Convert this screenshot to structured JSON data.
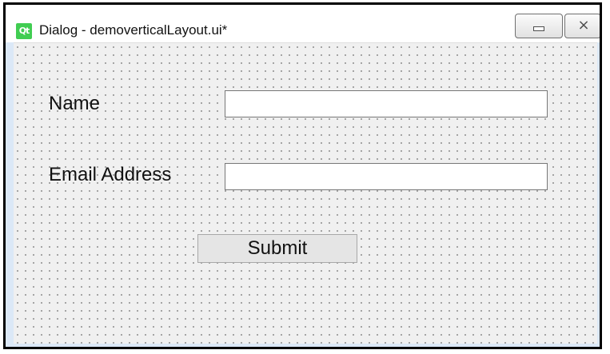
{
  "window": {
    "title": "Dialog - demoverticalLayout.ui*",
    "app_icon_text": "Qt",
    "app_icon_name": "qt-logo-icon",
    "minimize_icon_name": "minimize-icon",
    "close_icon_name": "close-icon"
  },
  "form": {
    "name_label": "Name",
    "name_value": "",
    "email_label": "Email Address",
    "email_value": "",
    "submit_label": "Submit"
  },
  "colors": {
    "canvas_background": "#f0f0f0",
    "grid_dot": "#a4a4a4",
    "frame_blue": "#dbe8f7",
    "qt_green": "#41cd52"
  }
}
